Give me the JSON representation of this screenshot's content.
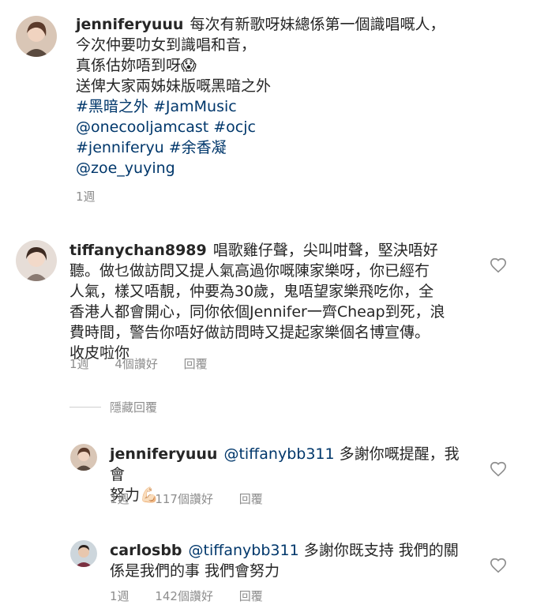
{
  "caption": {
    "username": "jenniferyuuu",
    "lines": [
      "每次有新歌呀妹總係第一個識唱嘅人，",
      "今次仲要叻女到識唱和音，",
      "真係估妳唔到呀😱",
      "送俾大家兩姊妹版嘅黑暗之外"
    ],
    "tag_lines": [
      "#黑暗之外 #JamMusic",
      "@onecooljamcast #ocjc",
      "#jenniferyu #余香凝",
      "@zoe_yuying"
    ],
    "time": "1週"
  },
  "comment1": {
    "username": "tiffanychan8989",
    "lines": [
      "唱歌雞仔聲，尖叫咁聲，堅決唔好",
      "聽。做乜做訪問又提人氣高過你嘅陳家樂呀，你已經冇",
      "人氣，樣又唔靚，仲要為30歲，鬼唔望家樂飛吃你，全",
      "香港人都會開心，同你依個Jennifer一齊Cheap到死，浪",
      "費時間，警告你唔好做訪問時又提起家樂個名博宣傳。",
      "收皮啦你"
    ],
    "time": "1週",
    "likes": "4個讚好",
    "reply": "回覆",
    "hide_replies": "隱藏回覆"
  },
  "reply1": {
    "username": "jenniferyuuu",
    "mention": "@tiffanybb311",
    "text1": "多謝你嘅提醒，我會",
    "text2": "努力💪🏻",
    "time": "1週",
    "likes": "117個讚好",
    "reply": "回覆"
  },
  "reply2": {
    "username": "carlosbb",
    "mention": "@tiffanybb311",
    "text1": "多謝你既支持 我們的關",
    "text2": "係是我們的事 我們會努力",
    "time": "1週",
    "likes": "142個讚好",
    "reply": "回覆"
  },
  "icons": {
    "heart": "heart-outline-icon",
    "avatar": "avatar"
  },
  "colors": {
    "link": "#00376b",
    "meta": "#8e8e8e",
    "text": "#262626"
  }
}
